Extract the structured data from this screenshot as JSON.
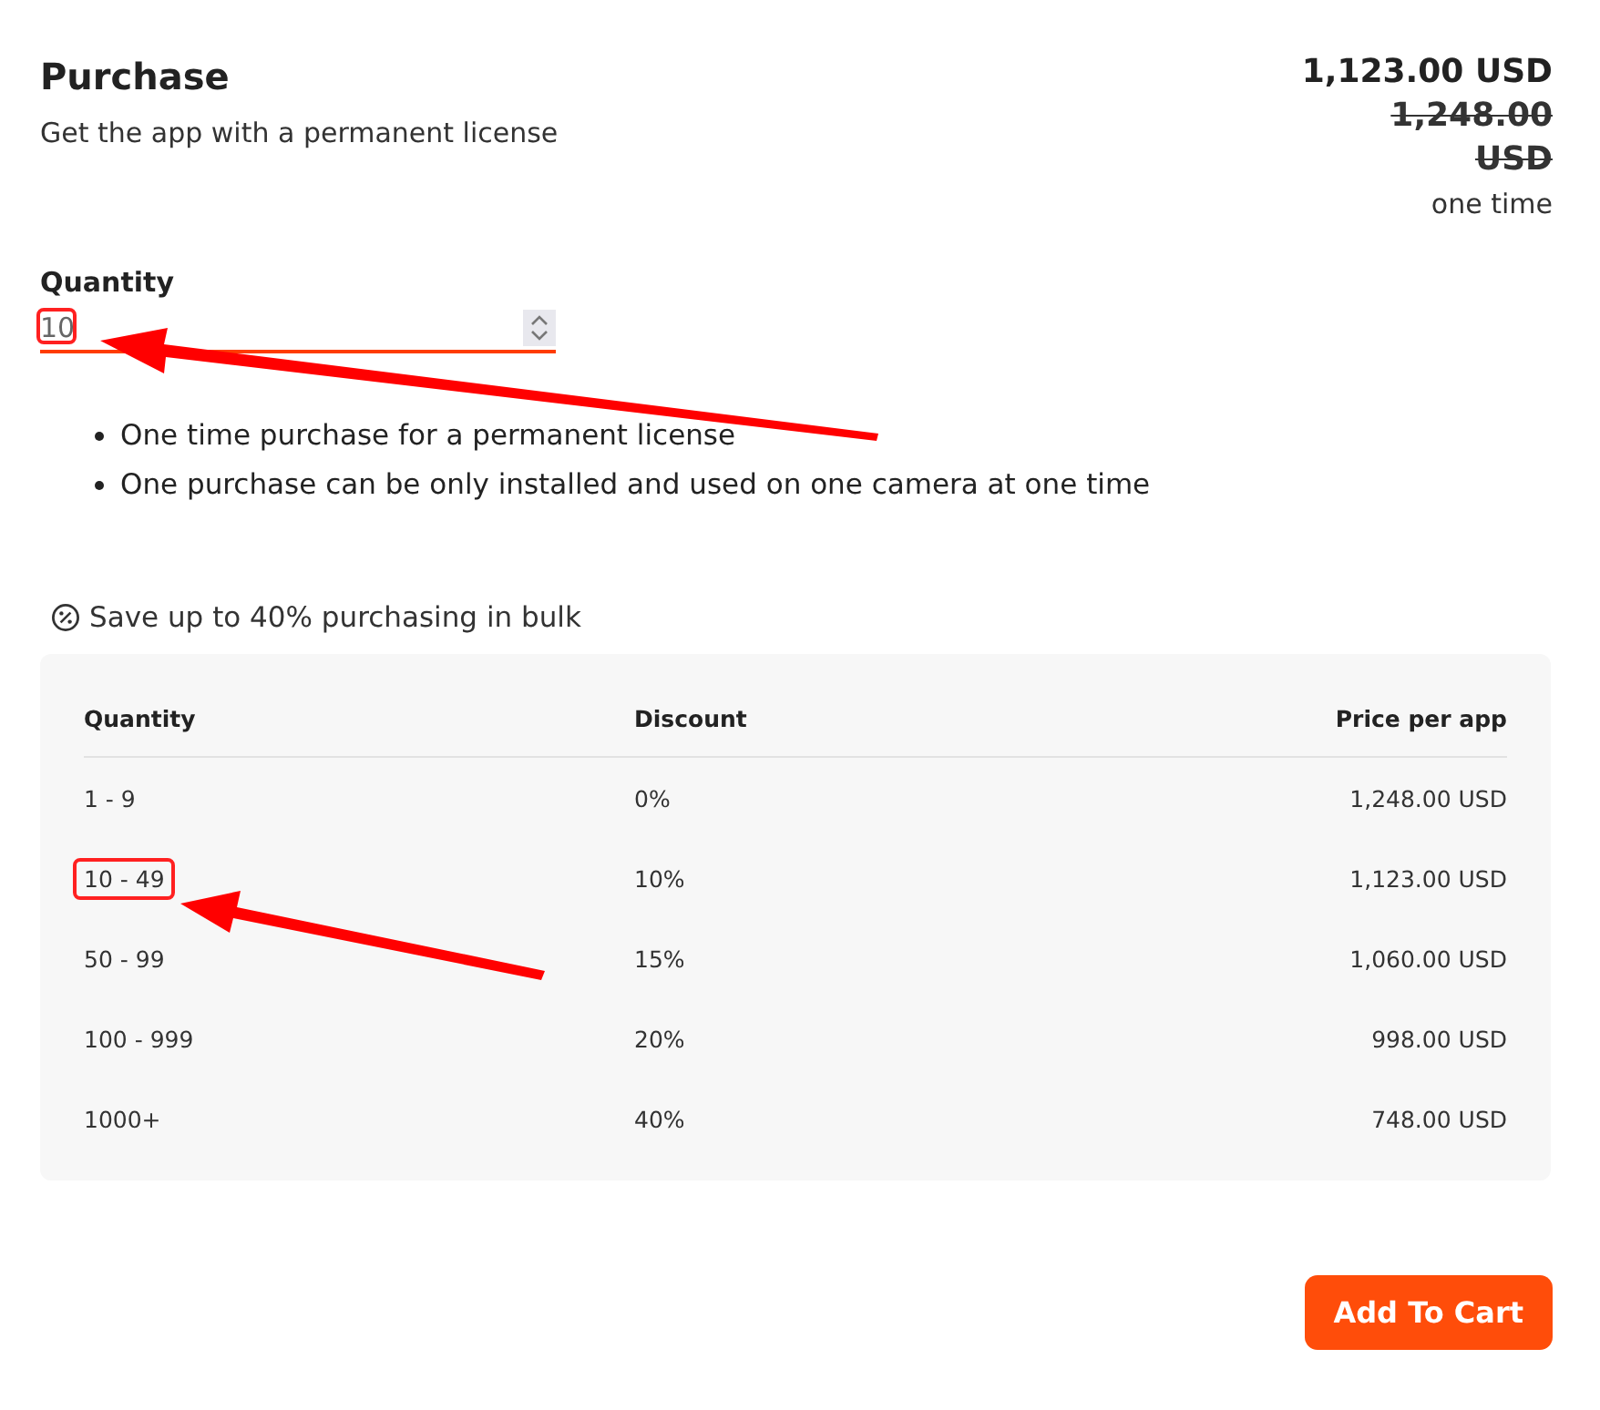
{
  "header": {
    "title": "Purchase",
    "subtitle": "Get the app with a permanent license",
    "price": "1,123.00 USD",
    "original_price": "1,248.00 USD",
    "price_note": "one time"
  },
  "quantity": {
    "label": "Quantity",
    "value": "10",
    "highlighted": true
  },
  "features": [
    "One time purchase for a permanent license",
    "One purchase can be only installed and used on one camera at one time"
  ],
  "bulk": {
    "note": "Save up to 40% purchasing in bulk",
    "columns": [
      "Quantity",
      "Discount",
      "Price per app"
    ],
    "rows": [
      {
        "cells": [
          "1 - 9",
          "0%",
          "1,248.00 USD"
        ],
        "highlighted": false
      },
      {
        "cells": [
          "10 - 49",
          "10%",
          "1,123.00 USD"
        ],
        "highlighted": true
      },
      {
        "cells": [
          "50 - 99",
          "15%",
          "1,060.00 USD"
        ],
        "highlighted": false
      },
      {
        "cells": [
          "100 - 999",
          "20%",
          "998.00 USD"
        ],
        "highlighted": false
      },
      {
        "cells": [
          "1000+",
          "40%",
          "748.00 USD"
        ],
        "highlighted": false
      }
    ]
  },
  "button": "Add To Cart"
}
